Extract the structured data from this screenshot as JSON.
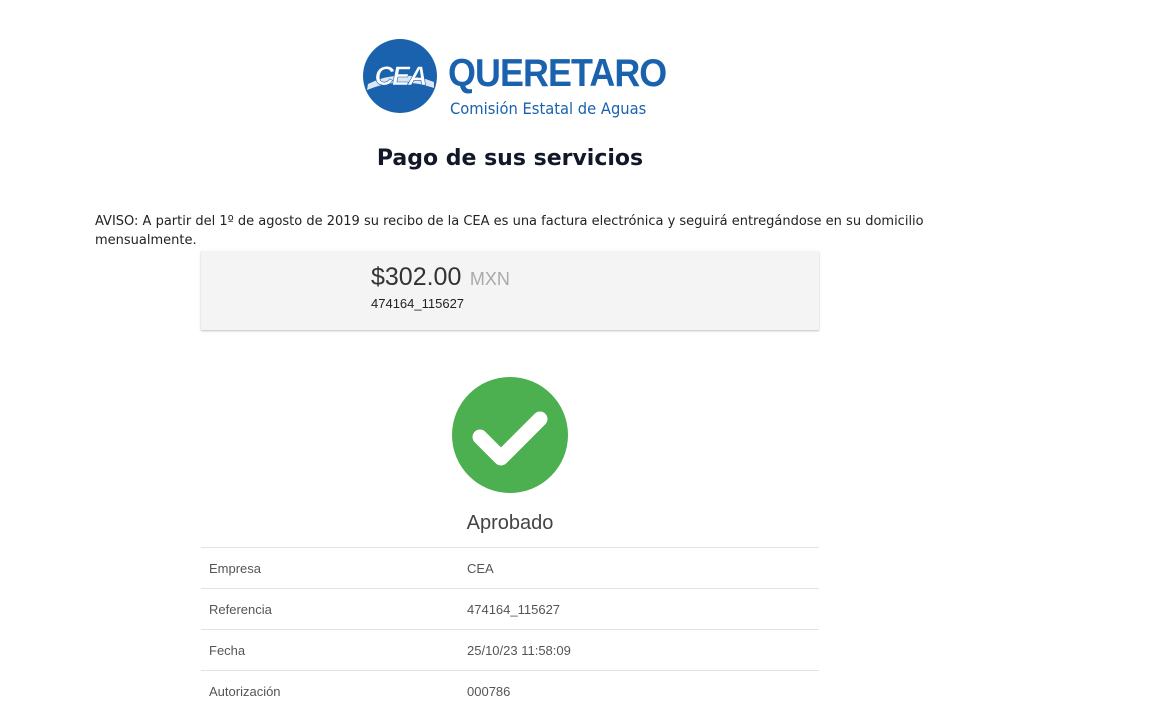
{
  "logo": {
    "mark_text": "CEA",
    "wordmark": "QUERETARO",
    "subtitle": "Comisión Estatal de Aguas",
    "brand_color": "#1a62ad"
  },
  "header": {
    "title": "Pago de sus servicios"
  },
  "notice": {
    "text": "AVISO: A partir del 1º de agosto de 2019 su recibo de la CEA es una factura electrónica y seguirá entregándose en su domicilio mensualmente."
  },
  "payment": {
    "amount": "$302.00",
    "currency": "MXN",
    "reference": "474164_115627"
  },
  "result": {
    "icon": "check-circle-icon",
    "status_color": "#4caf50",
    "status": "Aprobado"
  },
  "details": [
    {
      "label": "Empresa",
      "value": "CEA"
    },
    {
      "label": "Referencia",
      "value": "474164_115627"
    },
    {
      "label": "Fecha",
      "value": "25/10/23 11:58:09"
    },
    {
      "label": "Autorización",
      "value": "000786"
    }
  ]
}
